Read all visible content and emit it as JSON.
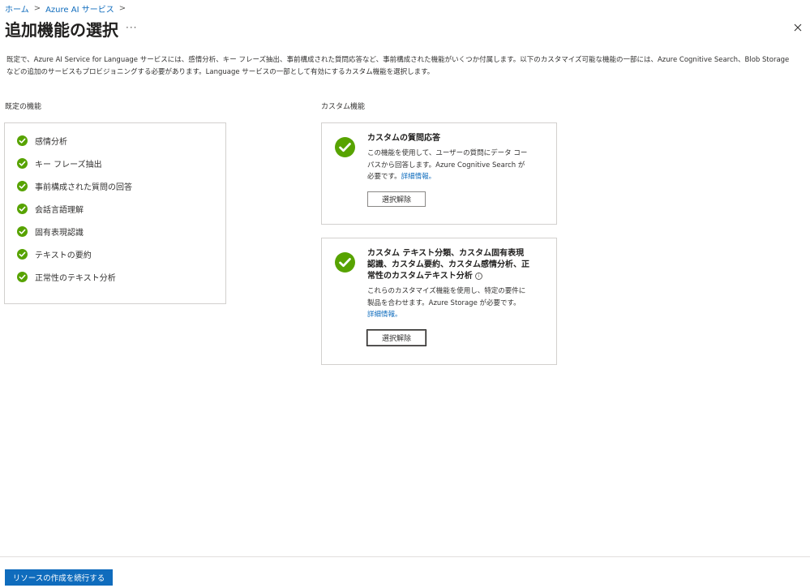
{
  "breadcrumb": {
    "items": [
      "ホーム",
      "Azure AI サービス"
    ],
    "separator": ">"
  },
  "page": {
    "title": "追加機能の選択",
    "more_label": "···"
  },
  "intro_text": "既定で、Azure AI Service for Language サービスには、感情分析、キー フレーズ抽出、事前構成された質問応答など、事前構成された機能がいくつか付属します。以下のカスタマイズ可能な機能の一部には、Azure Cognitive Search、Blob Storage などの追加のサービスもプロビジョニングする必要があります。Language サービスの一部として有効にするカスタム機能を選択します。",
  "default_features": {
    "label": "既定の機能",
    "items": [
      "感情分析",
      "キー フレーズ抽出",
      "事前構成された質問の回答",
      "会話言語理解",
      "固有表現認識",
      "テキストの要約",
      "正常性のテキスト分析"
    ]
  },
  "custom_features": {
    "label": "カスタム機能",
    "cards": [
      {
        "title": "カスタムの質問応答",
        "description": "この機能を使用して、ユーザーの質問にデータ コーパスから回答します。Azure Cognitive Search が必要です。",
        "learn_more": "詳細情報。",
        "button": "選択解除"
      },
      {
        "title": "カスタム テキスト分類、カスタム固有表現認識、カスタム要約、カスタム感情分析、正常性のカスタムテキスト分析",
        "info": "i",
        "description": "これらのカスタマイズ機能を使用し、特定の要件に製品を合わせます。Azure Storage が必要です。",
        "learn_more": "詳細情報。",
        "button": "選択解除"
      }
    ]
  },
  "footer": {
    "primary_button": "リソースの作成を続行する"
  },
  "colors": {
    "accent": "#0f6cbd",
    "check": "#57a300",
    "border": "#d2d0ce"
  },
  "icons": {
    "check": "check-circle-icon",
    "close": "close-icon",
    "more": "more-icon",
    "chevron": "chevron-right-icon",
    "info": "info-icon"
  }
}
